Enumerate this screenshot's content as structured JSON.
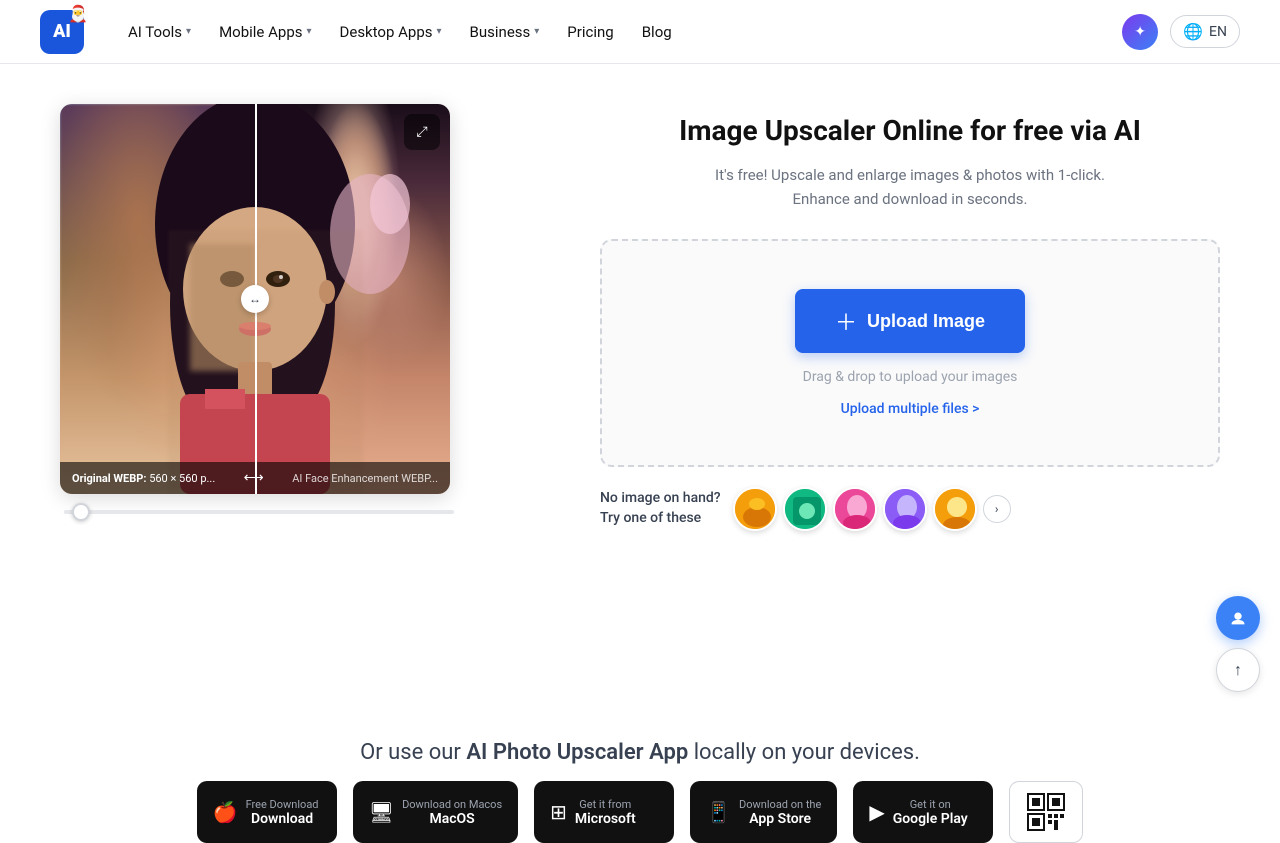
{
  "navbar": {
    "logo_text": "AI",
    "items": [
      {
        "label": "AI Tools",
        "has_dropdown": true
      },
      {
        "label": "Mobile Apps",
        "has_dropdown": true
      },
      {
        "label": "Desktop Apps",
        "has_dropdown": true
      },
      {
        "label": "Business",
        "has_dropdown": true
      },
      {
        "label": "Pricing",
        "has_dropdown": false
      },
      {
        "label": "Blog",
        "has_dropdown": false
      }
    ],
    "lang_label": "EN"
  },
  "hero": {
    "title": "Image Upscaler Online for free via AI",
    "subtitle_part1": "It's free! Upscale and enlarge images & photos with 1-click.",
    "subtitle_part2": "Enhance and download in seconds."
  },
  "upload": {
    "button_label": "Upload Image",
    "hint": "Drag & drop to upload your images",
    "multiple_label": "Upload multiple files >"
  },
  "samples": {
    "label_line1": "No image on hand?",
    "label_line2": "Try one of these"
  },
  "image_footer": {
    "left_prefix": "Original WEBP:",
    "left_value": "560 × 560 p...",
    "separator": "⟷",
    "right_label": "AI Face Enhancement WEBP..."
  },
  "bottom": {
    "title_prefix": "Or use our",
    "title_highlight": "AI Photo Upscaler App",
    "title_suffix": "locally on your devices."
  },
  "app_buttons": [
    {
      "icon": "🍎",
      "sub": "Free Download",
      "name": "Download"
    },
    {
      "icon": "🖥",
      "sub": "Download on Macos",
      "name": "MacOS"
    },
    {
      "icon": "⊞",
      "sub": "Get it from",
      "name": "Microsoft"
    },
    {
      "icon": "📱",
      "sub": "Download on the",
      "name": "App Store"
    },
    {
      "icon": "▶",
      "sub": "Get it on",
      "name": "Google Play"
    }
  ],
  "colors": {
    "primary": "#2563eb",
    "text_dark": "#111827",
    "text_medium": "#374151",
    "text_light": "#6b7280",
    "border": "#d1d5db"
  }
}
